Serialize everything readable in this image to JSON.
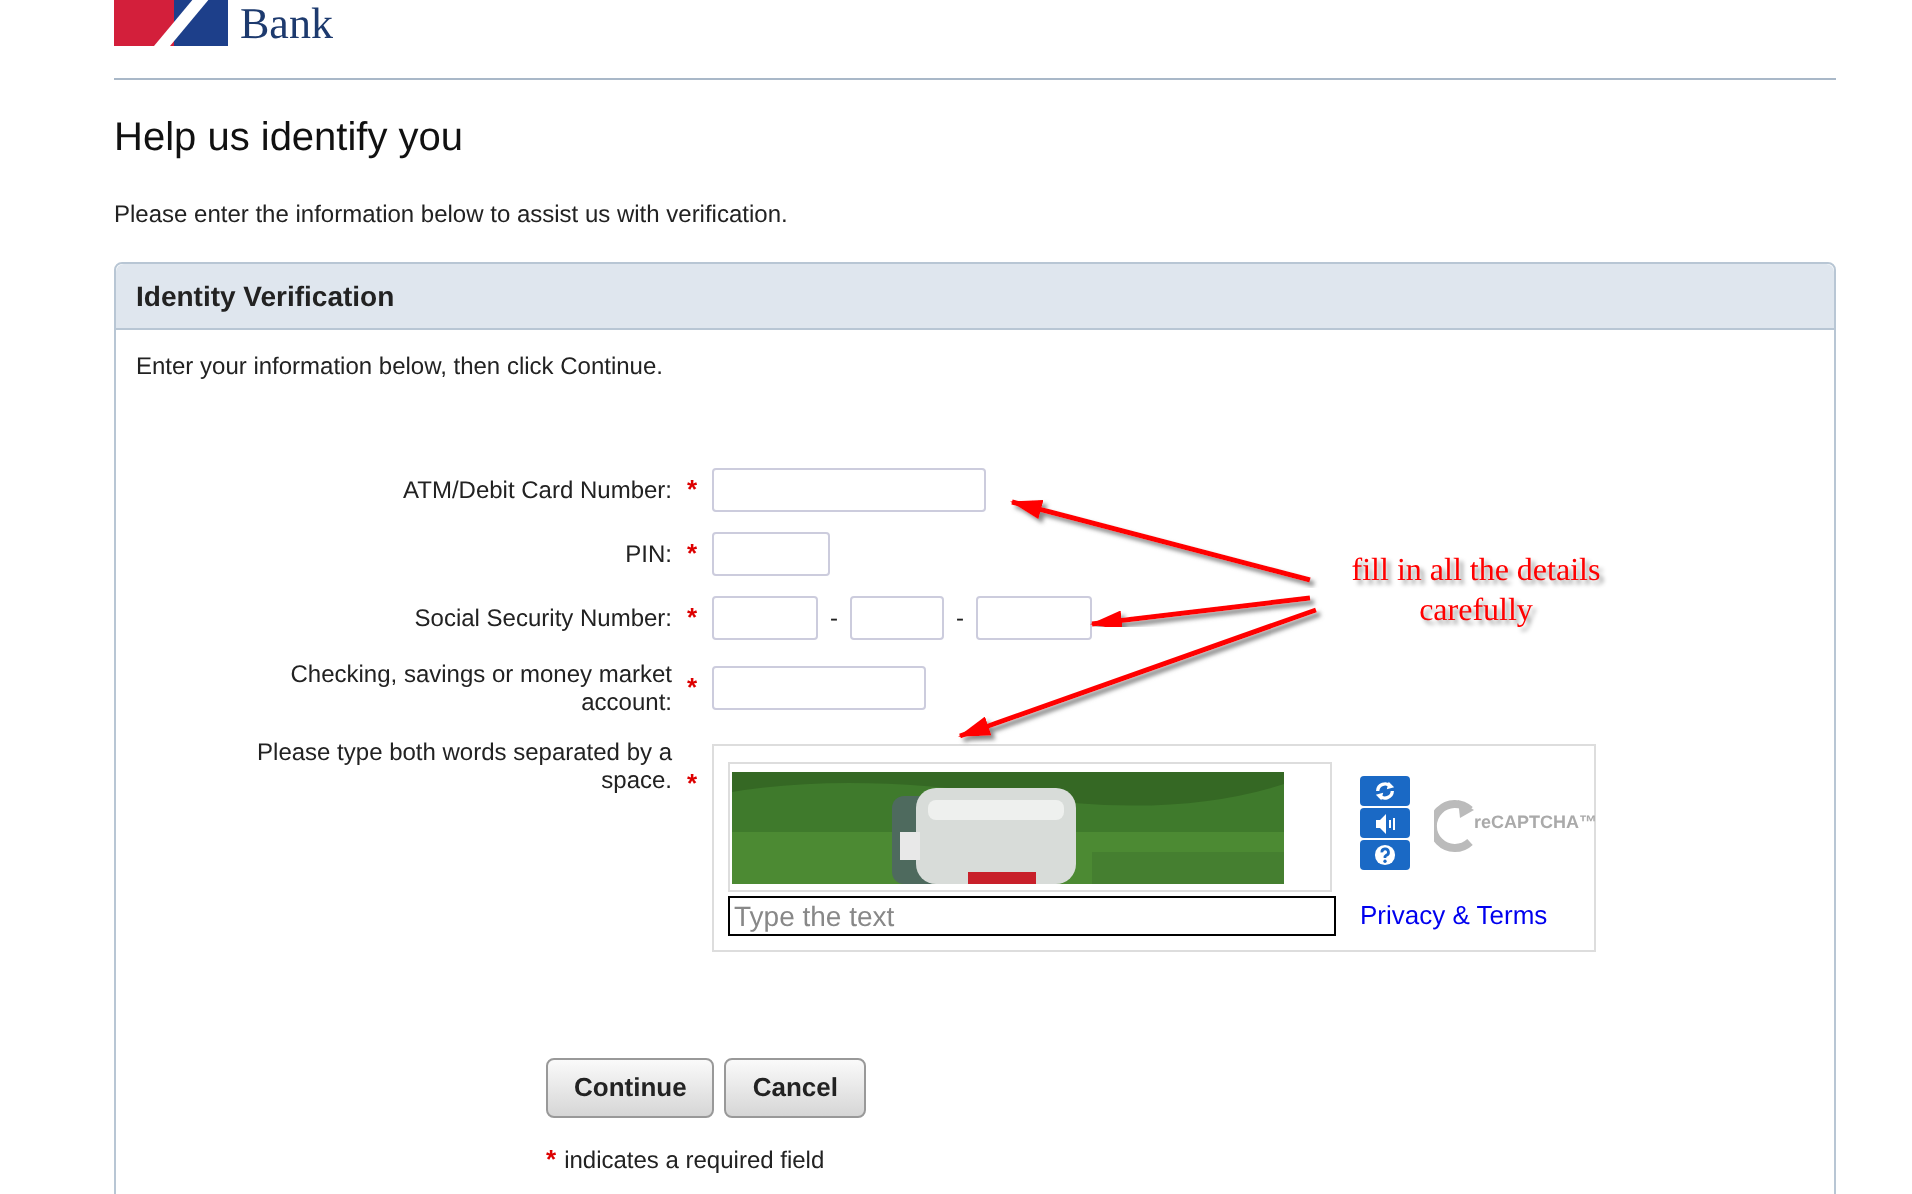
{
  "logo": {
    "text": "Bank"
  },
  "heading": "Help us identify you",
  "intro": "Please enter the information below to assist us with verification.",
  "panel": {
    "title": "Identity Verification",
    "instructions": "Enter your information below, then click Continue.",
    "fields": [
      {
        "kind": "single",
        "label": "ATM/Debit Card Number:",
        "required_mark": "*"
      },
      {
        "kind": "single",
        "label": "PIN:",
        "required_mark": "*"
      },
      {
        "kind": "ssn",
        "label": "Social Security Number:",
        "required_mark": "*",
        "separators": [
          "-",
          "-"
        ]
      },
      {
        "kind": "single",
        "label": "Checking, savings or money market account:",
        "required_mark": "*"
      }
    ],
    "captcha": {
      "label": "Please type both words separated by a space.",
      "required_mark": "*",
      "placeholder": "Type the text",
      "logo_text": "reCAPTCHA™",
      "link": "Privacy & Terms"
    },
    "buttons": [
      "Continue",
      "Cancel"
    ],
    "footnote": {
      "mark": "*",
      "text": "indicates a required field"
    }
  },
  "annotation": {
    "text": "fill in all the details carefully"
  }
}
